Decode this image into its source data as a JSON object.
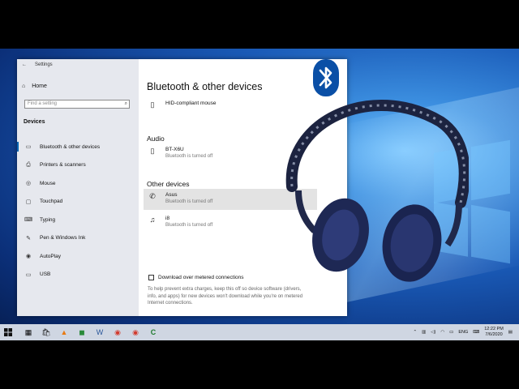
{
  "settings": {
    "window_title": "Settings",
    "home_label": "Home",
    "search_placeholder": "Find a setting",
    "section_header": "Devices",
    "nav": [
      {
        "label": "Bluetooth & other devices",
        "icon": "bluetooth-icon"
      },
      {
        "label": "Printers & scanners",
        "icon": "printer-icon"
      },
      {
        "label": "Mouse",
        "icon": "mouse-icon"
      },
      {
        "label": "Touchpad",
        "icon": "touchpad-icon"
      },
      {
        "label": "Typing",
        "icon": "keyboard-icon"
      },
      {
        "label": "Pen & Windows Ink",
        "icon": "pen-icon"
      },
      {
        "label": "AutoPlay",
        "icon": "autoplay-icon"
      },
      {
        "label": "USB",
        "icon": "usb-icon"
      }
    ]
  },
  "main": {
    "title": "Bluetooth & other devices",
    "mouse_device": "HID-compliant mouse",
    "audio_header": "Audio",
    "audio_device": {
      "name": "BT-X6U",
      "status": "Bluetooth is turned off"
    },
    "other_header": "Other devices",
    "other_devices": [
      {
        "name": "Asus",
        "status": "Bluetooth is turned off"
      },
      {
        "name": "i8",
        "status": "Bluetooth is turned off"
      }
    ],
    "metered_label": "Download over metered connections",
    "metered_help": "To help prevent extra charges, keep this off so device software (drivers, info, and apps) for new devices won't download while you're on metered Internet connections."
  },
  "taskbar": {
    "language": "ENG",
    "time": "12:22 PM",
    "date": "7/6/2020"
  },
  "colors": {
    "accent": "#0063b1",
    "bluetooth_logo": "#0a4fa6"
  }
}
